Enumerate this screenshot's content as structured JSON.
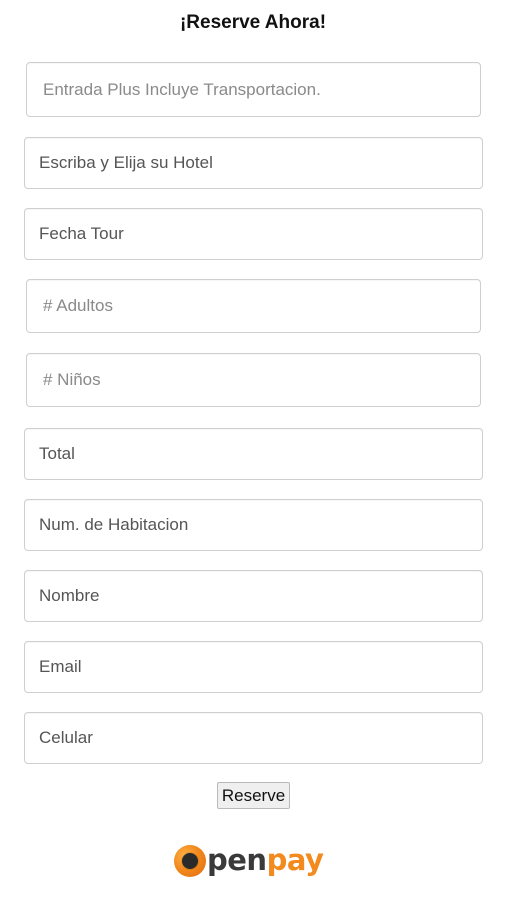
{
  "form": {
    "title": "¡Reserve Ahora!",
    "fields": {
      "entrada": {
        "placeholder": "Entrada Plus Incluye Transportacion.",
        "value": ""
      },
      "hotel": {
        "placeholder": "Escriba y Elija su Hotel",
        "value": ""
      },
      "fecha": {
        "placeholder": "Fecha Tour",
        "value": ""
      },
      "adultos": {
        "placeholder": "# Adultos",
        "value": ""
      },
      "ninos": {
        "placeholder": "# Niños",
        "value": ""
      },
      "total": {
        "placeholder": "Total",
        "value": ""
      },
      "habitacion": {
        "placeholder": "Num. de Habitacion",
        "value": ""
      },
      "nombre": {
        "placeholder": "Nombre",
        "value": ""
      },
      "email": {
        "placeholder": "Email",
        "value": ""
      },
      "celular": {
        "placeholder": "Celular",
        "value": ""
      }
    },
    "submit_label": "Reserve"
  },
  "footer": {
    "logo": {
      "icon": "openpay-o-icon",
      "text_dark": "pen",
      "text_orange": "pay",
      "colors": {
        "orange": "#f28a1e",
        "dark": "#3a3a3a"
      }
    }
  }
}
